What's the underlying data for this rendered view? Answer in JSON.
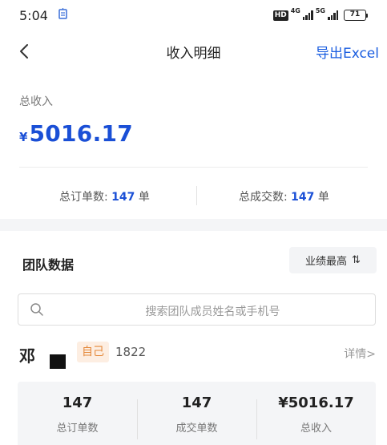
{
  "status_bar": {
    "time": "5:04",
    "network_1": "4G",
    "network_2": "5G",
    "hd_label": "HD",
    "battery": "71"
  },
  "nav": {
    "title": "收入明细",
    "export_label": "导出Excel"
  },
  "summary": {
    "label": "总收入",
    "currency": "¥",
    "amount": "5016.17",
    "orders_label": "总订单数: ",
    "orders_value": "147",
    "orders_unit": " 单",
    "deals_label": "总成交数: ",
    "deals_value": "147",
    "deals_unit": " 单"
  },
  "team": {
    "title": "团队数据",
    "sort_label": "业绩最高",
    "search_placeholder": "搜索团队成员姓名或手机号",
    "members": [
      {
        "surname": "邓",
        "tag": "自己",
        "id": "1822",
        "detail_label": "详情>",
        "stats": [
          {
            "value": "147",
            "label": "总订单数"
          },
          {
            "value": "147",
            "label": "成交单数"
          },
          {
            "value": "¥5016.17",
            "label": "总收入"
          }
        ]
      }
    ]
  },
  "colors": {
    "accent": "#1a4fd6",
    "link": "#1a5de0",
    "tag_bg": "#fdeee2",
    "tag_text": "#e58a3c"
  }
}
